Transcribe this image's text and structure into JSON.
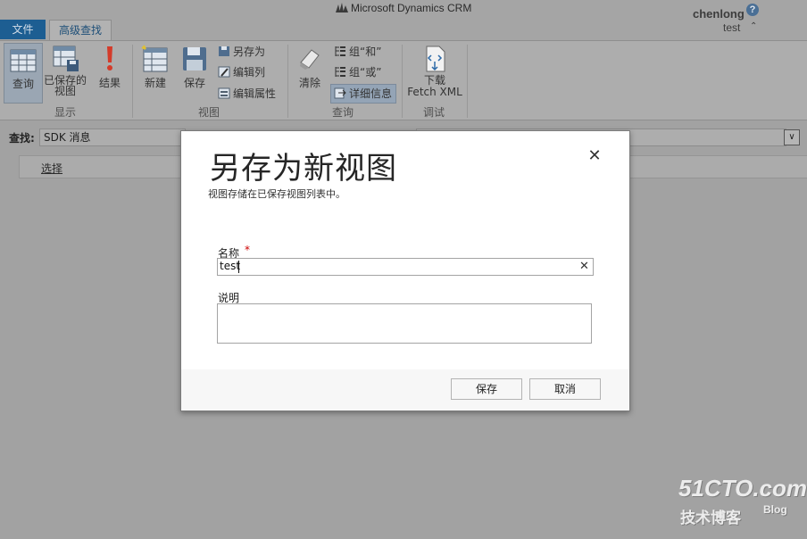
{
  "header": {
    "brand": "Microsoft Dynamics CRM",
    "user_name": "chenlong",
    "org_name": "test",
    "help_icon": "?"
  },
  "tabs": {
    "file": "文件",
    "advanced_find": "高级查找"
  },
  "ribbon": {
    "query": "查询",
    "saved_views": "已保存的视图",
    "results": "结果",
    "new": "新建",
    "save": "保存",
    "save_as": "另存为",
    "edit_columns": "编辑列",
    "edit_properties": "编辑属性",
    "clear": "清除",
    "group_and": "组“和”",
    "group_or": "组“或”",
    "details": "详细信息",
    "download": "下载",
    "fetch_xml": "Fetch XML",
    "group_show": "显示",
    "group_view": "视图",
    "group_query": "查询",
    "group_debug": "调试"
  },
  "search": {
    "find_label": "查找:",
    "entity": "SDK 消息",
    "select_link": "选择"
  },
  "dialog": {
    "title": "另存为新视图",
    "subtitle": "视图存储在已保存视图列表中。",
    "name_label": "名称",
    "required_mark": "*",
    "name_value": "test",
    "description_label": "说明",
    "save_button": "保存",
    "cancel_button": "取消",
    "close_icon": "close-icon"
  },
  "watermark": {
    "line1": "51CTO.com",
    "line2": "技术博客",
    "line3": "Blog"
  },
  "colors": {
    "file_tab": "#1d5e92",
    "overlay": "#a2a2a2",
    "required": "#cc0000"
  }
}
